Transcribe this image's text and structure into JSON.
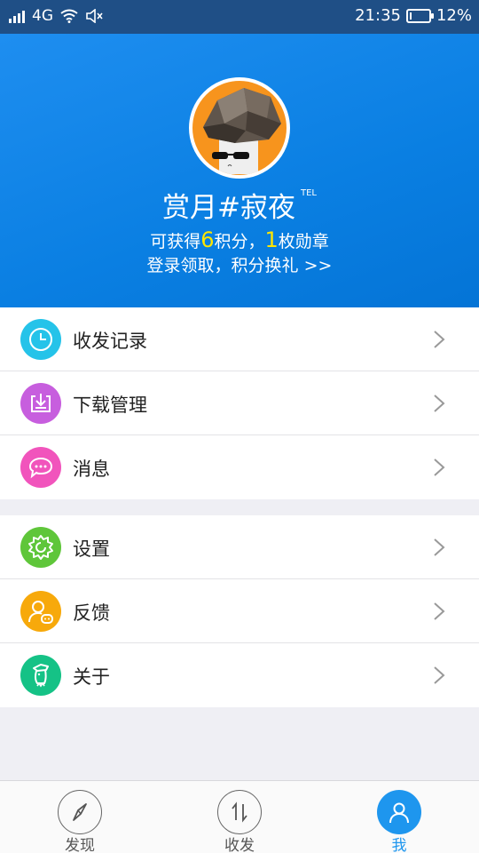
{
  "status_bar": {
    "network": "4G",
    "time": "21:35",
    "battery": "12%",
    "battery_level": 0.12
  },
  "profile": {
    "username": "赏月#寂夜",
    "badge": "TEL",
    "points_prefix": "可获得",
    "points_value": "6",
    "points_mid": "积分，",
    "medal_value": "1",
    "medal_suffix": "枚勋章",
    "login_prompt": "登录领取，积分换礼 >>"
  },
  "menu_group_1": [
    {
      "label": "收发记录",
      "icon": "clock-icon",
      "color": "#25c3e9"
    },
    {
      "label": "下载管理",
      "icon": "download-icon",
      "color": "#c75ede"
    },
    {
      "label": "消息",
      "icon": "chat-icon",
      "color": "#f154bc"
    }
  ],
  "menu_group_2": [
    {
      "label": "设置",
      "icon": "gear-icon",
      "color": "#5fc63a"
    },
    {
      "label": "反馈",
      "icon": "feedback-icon",
      "color": "#f7a90b"
    },
    {
      "label": "关于",
      "icon": "about-mascot-icon",
      "color": "#15c286"
    }
  ],
  "tabs": [
    {
      "label": "发现",
      "icon": "compass-icon",
      "active": false
    },
    {
      "label": "收发",
      "icon": "transfer-icon",
      "active": false
    },
    {
      "label": "我",
      "icon": "person-icon",
      "active": true
    }
  ],
  "colors": {
    "accent": "#1e96ee",
    "header_blue": "#0a7fe2",
    "status_bar": "#1f4f86",
    "highlight_yellow": "#ffe600"
  }
}
